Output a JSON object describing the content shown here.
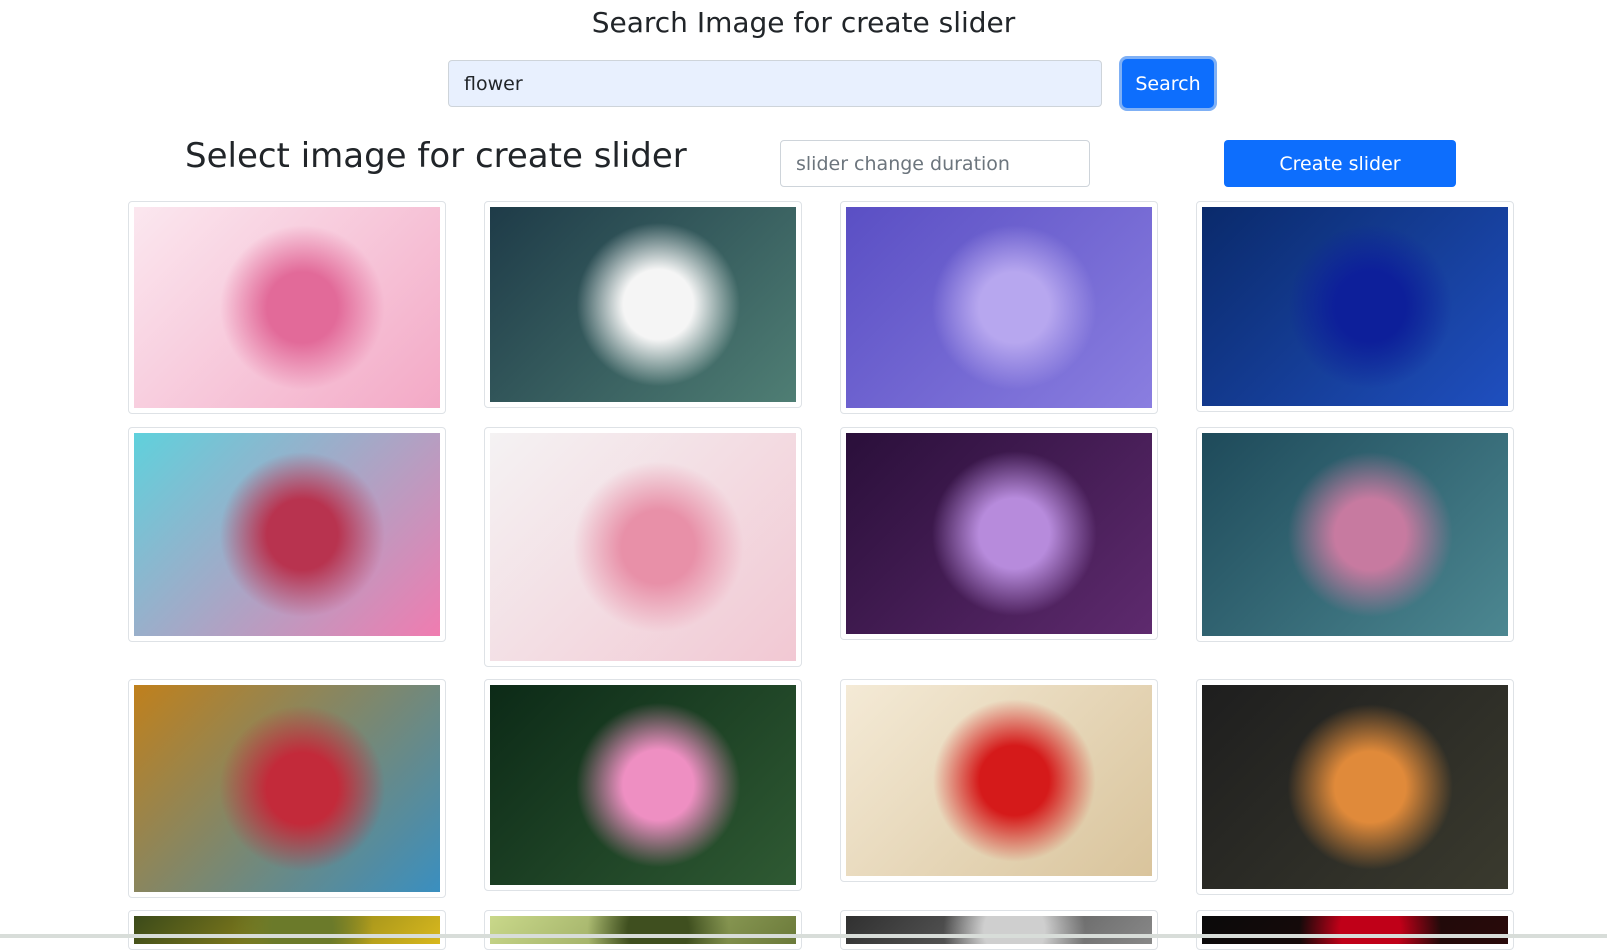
{
  "header": {
    "title": "Search Image for create slider"
  },
  "search": {
    "value": "flower",
    "button_label": "Search"
  },
  "slider_controls": {
    "title": "Select image for create slider",
    "duration_placeholder": "slider change duration",
    "create_label": "Create slider"
  },
  "gallery": [
    {
      "name": "cherry-blossom-image",
      "palette": [
        "#fbe7ef",
        "#f3a9c6",
        "#e26a99"
      ]
    },
    {
      "name": "white-daisy-image",
      "palette": [
        "#1e3b48",
        "#4f7e74",
        "#f5f5f5"
      ]
    },
    {
      "name": "water-lily-purple-image",
      "palette": [
        "#5a4fc4",
        "#8a7ee0",
        "#b7a7ef"
      ]
    },
    {
      "name": "blue-rose-image",
      "palette": [
        "#0a2a6b",
        "#1f4fbf",
        "#0d1f9a"
      ]
    },
    {
      "name": "pink-daisy-closeup-image",
      "palette": [
        "#5fd1dc",
        "#f07cb0",
        "#b8334f"
      ]
    },
    {
      "name": "pink-ranunculus-bouquet-image",
      "palette": [
        "#f4f2f3",
        "#f2c8d3",
        "#e890a8"
      ]
    },
    {
      "name": "purple-osteospermum-image",
      "palette": [
        "#2a0f3a",
        "#5e2a6e",
        "#b78bdc"
      ]
    },
    {
      "name": "rainbow-rose-image",
      "palette": [
        "#1e4a5a",
        "#4c8791",
        "#c77aa0"
      ]
    },
    {
      "name": "red-water-lily-image",
      "palette": [
        "#c0801c",
        "#3a8fc0",
        "#c32a3a"
      ]
    },
    {
      "name": "pink-lotus-image",
      "palette": [
        "#0c2a17",
        "#2f5a33",
        "#ee8fc2"
      ]
    },
    {
      "name": "red-poppy-field-image",
      "palette": [
        "#f4ead6",
        "#d9c49c",
        "#d51a1a"
      ]
    },
    {
      "name": "orange-roses-image",
      "palette": [
        "#1e1e1e",
        "#3a3a2e",
        "#e08a3a"
      ]
    },
    {
      "name": "yellow-flower-image",
      "palette": [
        "#3b4a1a",
        "#d8b81d",
        "#6b7a2a"
      ]
    },
    {
      "name": "green-garden-image",
      "palette": [
        "#c9d88a",
        "#6b7a3a",
        "#3f4f1f"
      ]
    },
    {
      "name": "gray-flower-image",
      "palette": [
        "#303030",
        "#888888",
        "#cfcfcf"
      ]
    },
    {
      "name": "dark-red-flower-image",
      "palette": [
        "#0a0a0a",
        "#2a0a0a",
        "#c00018"
      ]
    }
  ]
}
